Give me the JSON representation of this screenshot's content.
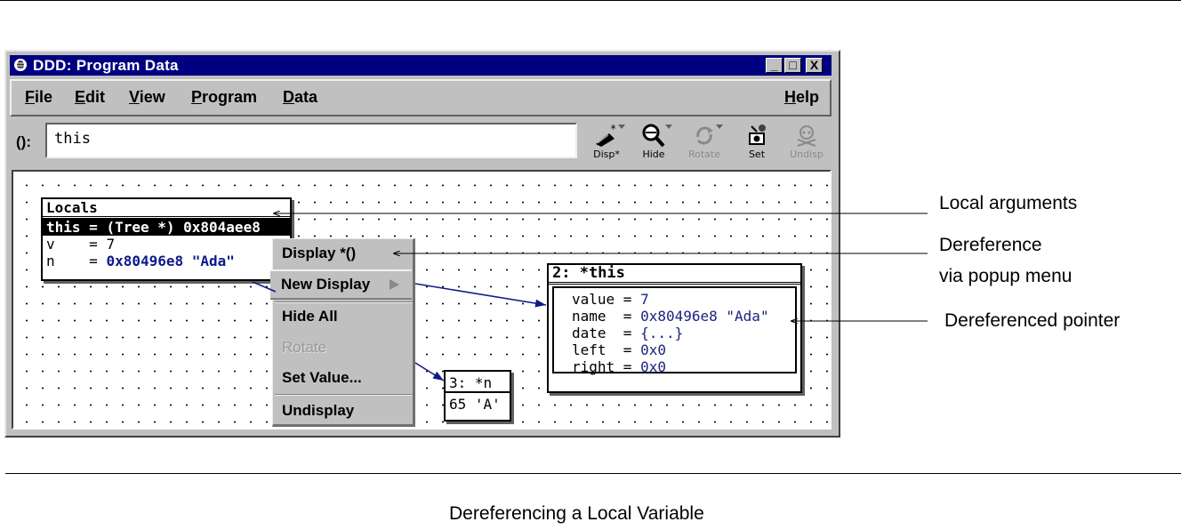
{
  "window": {
    "title": "DDD: Program Data",
    "controls": {
      "minimize": "_",
      "maximize": "□",
      "close": "X"
    }
  },
  "menubar": {
    "items": [
      {
        "label": "File",
        "mnemonic": "F",
        "rest": "ile"
      },
      {
        "label": "Edit",
        "mnemonic": "E",
        "rest": "dit"
      },
      {
        "label": "View",
        "mnemonic": "V",
        "rest": "iew"
      },
      {
        "label": "Program",
        "mnemonic": "P",
        "rest": "rogram"
      },
      {
        "label": "Data",
        "mnemonic": "D",
        "rest": "ata"
      }
    ],
    "help": {
      "label": "Help",
      "mnemonic": "H",
      "rest": "elp"
    }
  },
  "argument": {
    "label": "():",
    "value": "this"
  },
  "toolbar": [
    {
      "id": "disp",
      "label": "Disp*",
      "icon": "display-icon",
      "enabled": true,
      "dropdown": true
    },
    {
      "id": "hide",
      "label": "Hide",
      "icon": "magnifier-icon",
      "enabled": true,
      "dropdown": true
    },
    {
      "id": "rotate",
      "label": "Rotate",
      "icon": "rotate-icon",
      "enabled": false,
      "dropdown": true
    },
    {
      "id": "set",
      "label": "Set",
      "icon": "set-icon",
      "enabled": true,
      "dropdown": false
    },
    {
      "id": "undisp",
      "label": "Undisp",
      "icon": "skull-icon",
      "enabled": false,
      "dropdown": false
    }
  ],
  "displays": {
    "locals": {
      "title": "Locals",
      "rows": [
        {
          "name": "this",
          "sep": " = ",
          "value": "(Tree *) 0x804aee8",
          "selected": true
        },
        {
          "name": "v   ",
          "sep": " = ",
          "value": "7",
          "selected": false
        },
        {
          "name": "n   ",
          "sep": " = ",
          "value": "0x80496e8 \"Ada\"",
          "selected": false
        }
      ]
    },
    "this_node": {
      "title": "2: *this",
      "rows": [
        {
          "name": "value",
          "sep": " = ",
          "value": "7"
        },
        {
          "name": "name ",
          "sep": " = ",
          "value": "0x80496e8 \"Ada\""
        },
        {
          "name": "date ",
          "sep": " = ",
          "value": "{...}"
        },
        {
          "name": "left ",
          "sep": " = ",
          "value": "0x0"
        },
        {
          "name": "right",
          "sep": " = ",
          "value": "0x0"
        }
      ]
    },
    "n_node": {
      "title": "3: *n",
      "value": "65 'A'"
    }
  },
  "popup_menu": {
    "items": [
      {
        "label": "Display *()",
        "enabled": true
      },
      {
        "label": "New Display",
        "enabled": true,
        "submenu": true
      },
      {
        "label": "Hide All",
        "enabled": true
      },
      {
        "label": "Rotate",
        "enabled": false
      },
      {
        "label": "Set Value...",
        "enabled": true
      },
      {
        "label": "Undisplay",
        "enabled": true
      }
    ]
  },
  "annotations": {
    "local_arguments": "Local arguments",
    "dereference_line1": "Dereference",
    "dereference_line2": "via popup menu",
    "dereferenced_pointer": "Dereferenced pointer"
  },
  "caption": "Dereferencing a Local Variable",
  "colors": {
    "titlebar": "#000080",
    "chrome": "#c0c0c0",
    "pointer_value": "#1a237e"
  }
}
